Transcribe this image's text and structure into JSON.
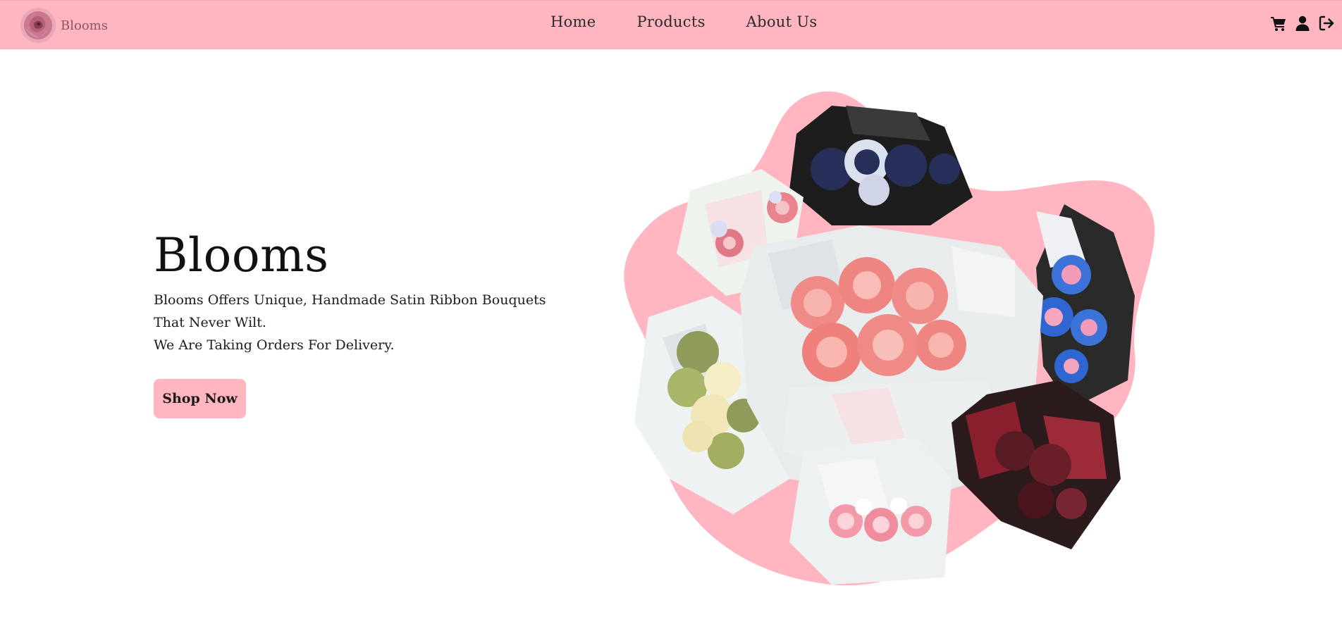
{
  "brand": {
    "name": "Blooms",
    "logo_icon": "rose-logo-icon"
  },
  "nav": {
    "links": [
      {
        "label": "Home"
      },
      {
        "label": "Products"
      },
      {
        "label": "About Us"
      }
    ],
    "icons": [
      "cart-icon",
      "user-icon",
      "logout-icon"
    ]
  },
  "hero": {
    "title": "Blooms",
    "description_line1": "Blooms Offers Unique, Handmade Satin Ribbon Bouquets That Never Wilt.",
    "description_line2": "We Are Taking Orders For Delivery.",
    "cta_label": "Shop Now",
    "image": "bouquet-collage-image"
  },
  "colors": {
    "nav_bg": "#ffb6c1",
    "blob": "#ffb6c1",
    "button_bg": "#ffb6c1"
  }
}
